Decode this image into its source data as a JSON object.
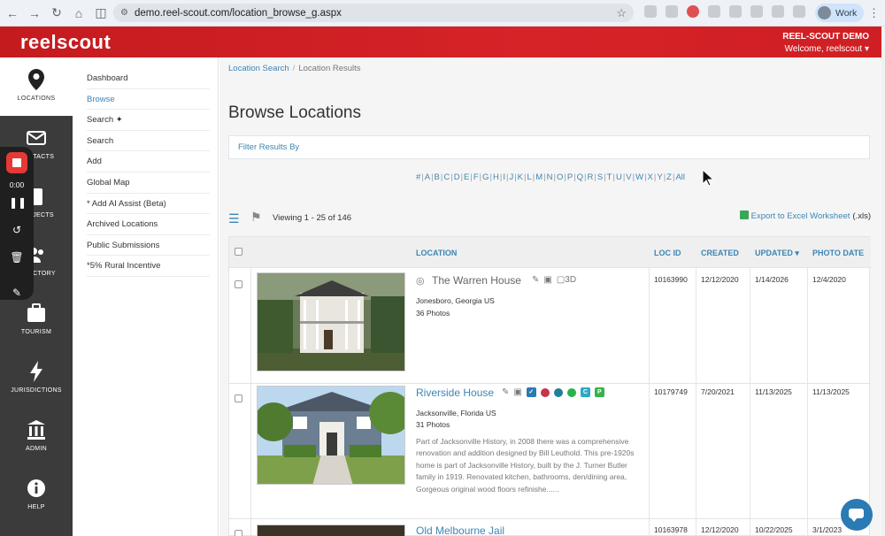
{
  "browser": {
    "url": "demo.reel-scout.com/location_browse_g.aspx",
    "profile_label": "Work"
  },
  "header": {
    "logo": "reelscout",
    "account": "REEL-SCOUT DEMO",
    "welcome": "Welcome, reelscout ▾",
    "brand_color": "#d1202a"
  },
  "sidebar": {
    "items": [
      {
        "label": "LOCATIONS",
        "icon": "map-pin-icon"
      },
      {
        "label": "CONTACTS",
        "icon": "envelope-icon"
      },
      {
        "label": "PROJECTS",
        "icon": "clipboard-icon"
      },
      {
        "label": "DIRECTORY",
        "icon": "people-icon"
      },
      {
        "label": "TOURISM",
        "icon": "suitcase-icon"
      },
      {
        "label": "JURISDICTIONS",
        "icon": "bolt-icon"
      },
      {
        "label": "ADMIN",
        "icon": "building-icon"
      },
      {
        "label": "HELP",
        "icon": "info-icon"
      }
    ]
  },
  "recorder": {
    "time": "0:00"
  },
  "submenu": {
    "items": [
      "Dashboard",
      "Browse",
      "Search ✦",
      "Search",
      "Add",
      "Global Map",
      "* Add AI Assist (Beta)",
      "Archived Locations",
      "Public Submissions",
      "*5% Rural Incentive"
    ]
  },
  "main": {
    "breadcrumb": {
      "link": "Location Search",
      "sep": "/",
      "current": "Location Results"
    },
    "title": "Browse Locations",
    "filter_label": "Filter Results By",
    "alphabet": [
      "#",
      "A",
      "B",
      "C",
      "D",
      "E",
      "F",
      "G",
      "H",
      "I",
      "J",
      "K",
      "L",
      "M",
      "N",
      "O",
      "P",
      "Q",
      "R",
      "S",
      "T",
      "U",
      "V",
      "W",
      "X",
      "Y",
      "Z",
      "All"
    ],
    "viewing": "Viewing 1 - 25 of 146",
    "export_label": "Export to Excel Worksheet",
    "export_ext": "(.xls)",
    "columns": [
      "LOCATION",
      "LOC ID",
      "CREATED",
      "UPDATED ▾",
      "PHOTO DATE"
    ],
    "rows": [
      {
        "name": "The Warren House",
        "city": "Jonesboro, Georgia US",
        "photos": "36 Photos",
        "description": "",
        "loc_id": "10163990",
        "created": "12/12/2020",
        "updated": "1/14/2026",
        "photo_date": "12/4/2020",
        "tag_3d": "3D"
      },
      {
        "name": "Riverside House",
        "city": "Jacksonville, Florida US",
        "photos": "31 Photos",
        "description": "Part of Jacksonville History, in 2008 there was a comprehensive renovation and addition designed by Bill Leuthold. This pre-1920s home is part of Jacksonville History, built by the J. Turner Butler family in 1919. Renovated kitchen, bathrooms, den/dining area, Gorgeous original wood floors refinishe......",
        "loc_id": "10179749",
        "created": "7/20/2021",
        "updated": "11/13/2025",
        "photo_date": "11/13/2025",
        "badges": [
          "C",
          "P"
        ]
      },
      {
        "name": "Old Melbourne Jail",
        "city": "",
        "photos": "",
        "description": "",
        "loc_id": "10163978",
        "created": "12/12/2020",
        "updated": "10/22/2025",
        "photo_date": "3/1/2023"
      }
    ]
  }
}
